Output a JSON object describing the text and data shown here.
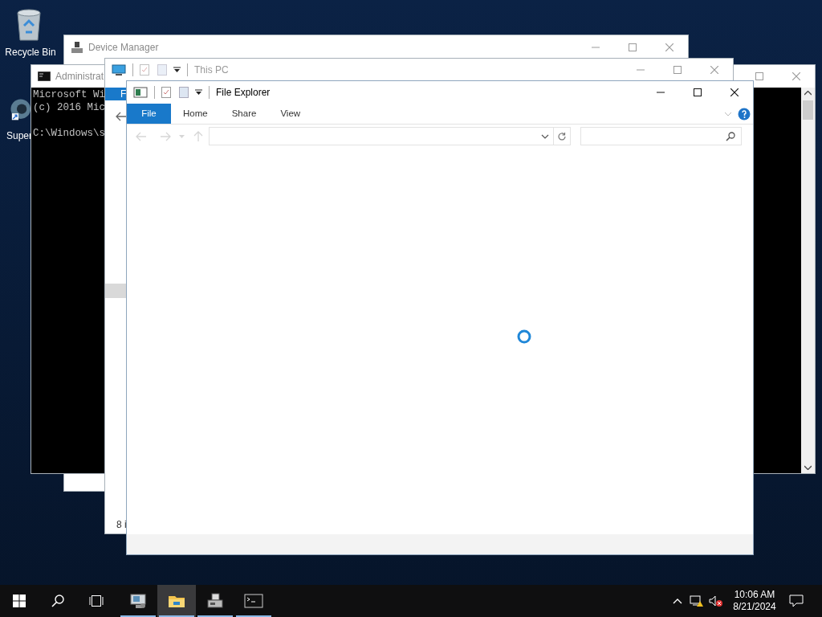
{
  "desktop_icons": [
    {
      "kind": "recycle_bin",
      "label": "Recycle Bin"
    },
    {
      "kind": "shortcut",
      "label": "Super"
    }
  ],
  "windows": [
    {
      "kind": "device_manager",
      "title": "Device Manager"
    },
    {
      "kind": "console",
      "title": "Administrat",
      "lines": [
        "Microsoft Wi",
        "(c) 2016 Mic",
        "C:\\Windows\\s"
      ]
    },
    {
      "kind": "explorer_behind",
      "title": "This PC",
      "ribbon_tab": "F",
      "status": "8 i"
    },
    {
      "kind": "explorer",
      "title": "File Explorer",
      "loading": true,
      "tabs": [
        {
          "kind": "file",
          "label": "File"
        },
        {
          "kind": "tab",
          "label": "Home"
        },
        {
          "kind": "tab",
          "label": "Share"
        },
        {
          "kind": "tab",
          "label": "View"
        }
      ]
    }
  ],
  "taskbar": {
    "apps": [
      {
        "kind": "server_manager",
        "active": false
      },
      {
        "kind": "folder",
        "active": true
      },
      {
        "kind": "device",
        "active": false
      },
      {
        "kind": "console",
        "active": false
      }
    ],
    "clock": {
      "time": "10:06 AM",
      "date": "8/21/2024"
    }
  }
}
